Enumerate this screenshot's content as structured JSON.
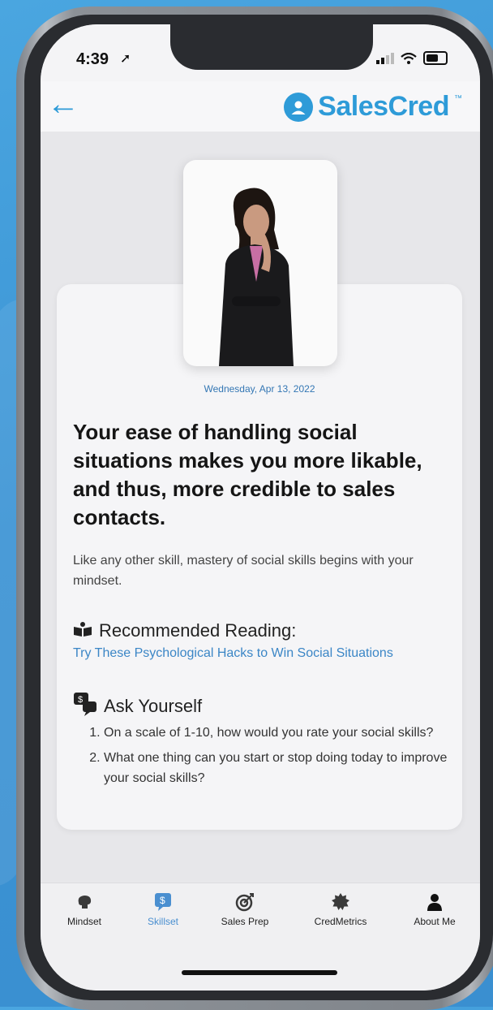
{
  "status": {
    "time": "4:39"
  },
  "header": {
    "brand": "SalesCred",
    "trademark": "™"
  },
  "article": {
    "date": "Wednesday, Apr 13, 2022",
    "headline": "Your ease of handling social situations makes you more likable, and thus, more credible to sales contacts.",
    "intro": "Like any other skill, mastery of social skills begins with your mindset.",
    "recommended": {
      "title": "Recommended Reading:",
      "link": "Try These Psychological Hacks to Win Social Situations"
    },
    "ask": {
      "title": "Ask Yourself",
      "items": [
        "On a scale of 1-10, how would you rate your social skills?",
        "What one thing can you start or stop doing today to improve your social skills?"
      ]
    }
  },
  "tabs": [
    {
      "label": "Mindset",
      "icon": "brain-icon"
    },
    {
      "label": "Skillset",
      "icon": "chat-dollar-icon",
      "active": true
    },
    {
      "label": "Sales Prep",
      "icon": "target-icon"
    },
    {
      "label": "CredMetrics",
      "icon": "badge-icon"
    },
    {
      "label": "About Me",
      "icon": "person-icon"
    }
  ],
  "colors": {
    "accent": "#2e9bd8",
    "link": "#3b86c6",
    "active_tab": "#4a8fd0"
  }
}
